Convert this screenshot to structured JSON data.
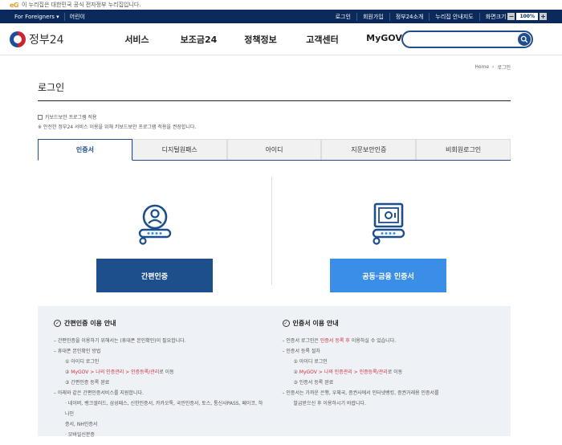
{
  "gov_banner": {
    "mark": "eG",
    "text": "이 누리집은 대한민국 공식 전자정부 누리집입니다."
  },
  "util": {
    "left": [
      "For Foreigners ▾",
      "어린이"
    ],
    "right": [
      "로그인",
      "회원가입",
      "정부24소개",
      "누리집 안내지도",
      "화면크기"
    ],
    "zoom_minus": "−",
    "zoom_value": "100%",
    "zoom_plus": "+"
  },
  "header": {
    "logo_text": "정부24",
    "nav": [
      "서비스",
      "보조금24",
      "정책정보",
      "고객센터",
      "MyGOV"
    ],
    "search_placeholder": ""
  },
  "breadcrumb": {
    "home": "Home",
    "sep": "›",
    "current": "로그인"
  },
  "page": {
    "title": "로그인",
    "keyboard_label": "키보드보안 프로그램 적용",
    "keyboard_note": "※ 안전한 정부24 서비스 이용을 위해 키보드보안 프로그램 적용을 권장합니다."
  },
  "tabs": [
    "인증서",
    "디지털원패스",
    "아이디",
    "지문보안인증",
    "비회원로그인"
  ],
  "auth": {
    "simple_label": "간편인증",
    "joint_label": "공동·금융 인증서"
  },
  "info_left": {
    "title": "간편인증 이용 안내",
    "lines": [
      {
        "text": "– 간편인증을 이용하기 위해서는 (휴대폰 본인확인)이 필요합니다.",
        "sub": false
      },
      {
        "text": "– 휴대폰 본인확인 방법",
        "sub": false
      },
      {
        "text": "① 아이디 로그인",
        "sub": true
      },
      {
        "pre": "② ",
        "red": "MyGOV > 나의 인증관리 > 인증등록/관리",
        "post": "로 이동",
        "sub": true
      },
      {
        "text": "③ 간편인증 등록 완료",
        "sub": true
      },
      {
        "text": "– 아래와 같은 간편인증서비스를 지원합니다.",
        "sub": false
      },
      {
        "text": "· 네이버, 뱅크샐러드, 삼성패스, 신한인증서, 카카오톡, 국민인증서, 토스, 통신사PASS, 페이코, 하나인",
        "sub": true
      },
      {
        "text": "증서, NH인증서",
        "sub": true
      },
      {
        "text": "· 모바일신분증",
        "sub": true
      }
    ]
  },
  "info_right": {
    "title": "인증서 이용 안내",
    "lines": [
      {
        "pre": "– 인증서 로그인은 ",
        "red": "인증서 등록 후",
        "post": " 이용하실 수 있습니다.",
        "sub": false
      },
      {
        "text": "– 인증서 등록 절차",
        "sub": false
      },
      {
        "text": "① 아이디 로그인",
        "sub": true
      },
      {
        "pre": "② ",
        "red": "MyGOV > 나의 인증관리 > 인증등록/관리",
        "post": "로 이동",
        "sub": true
      },
      {
        "text": "③ 인증서 등록 완료",
        "sub": true
      },
      {
        "text": "– 인증서는 가까운 은행, 우체국, 증권사에서 인터넷뱅킹, 증권거래용 인증서를",
        "sub": false
      },
      {
        "text": "발급받으신 후 이용하시기 바랍니다.",
        "sub": true
      }
    ]
  },
  "colors": {
    "navy": "#0b2a5b",
    "primary": "#1c4f8b",
    "accent": "#3a8ee6",
    "red": "#d0313a"
  }
}
